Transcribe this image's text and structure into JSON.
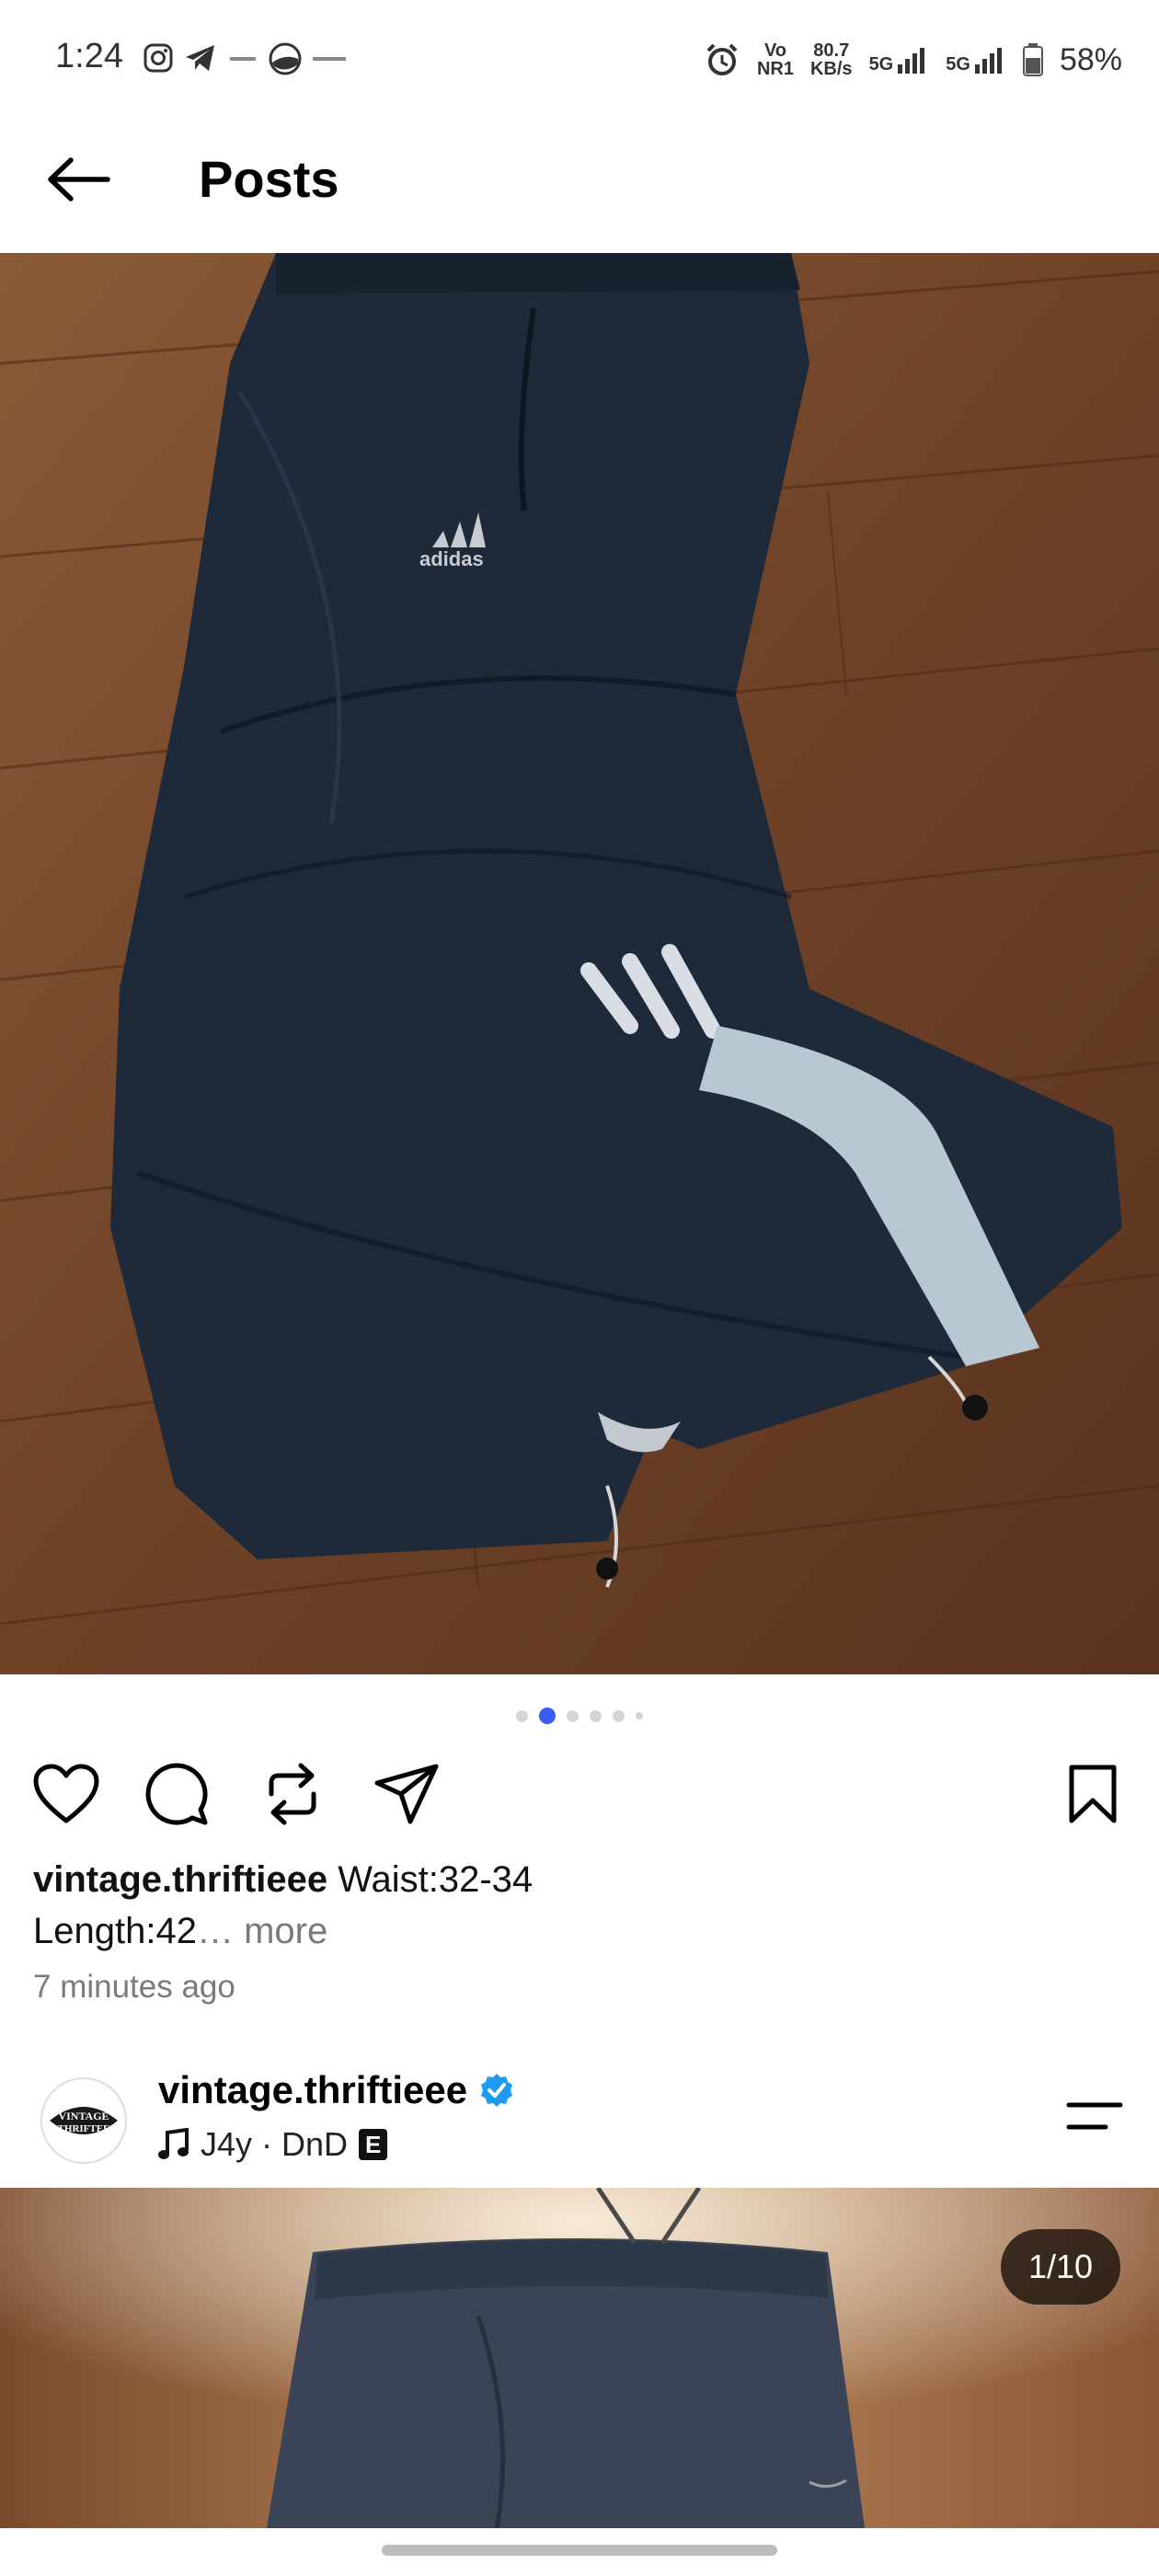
{
  "status_bar": {
    "time": "1:24",
    "left_icons": [
      "instagram-icon",
      "telegram-icon",
      "zepto-icon",
      "zomato-icon"
    ],
    "vo_top": "Vo",
    "vo_bottom": "NR1",
    "speed_top": "80.7",
    "speed_bottom": "KB/s",
    "net1": "5G",
    "net2": "5G",
    "battery": "58%"
  },
  "header": {
    "title": "Posts",
    "back_icon": "arrow-left-icon"
  },
  "post": {
    "carousel_dots": 6,
    "active_dot": 1,
    "username": "vintage.thriftieee",
    "caption_line1": "Waist:32-34",
    "caption_line2": "Length:42",
    "more_label": "… more",
    "time_ago": "7 minutes ago",
    "actions": [
      "heart-icon",
      "comment-icon",
      "repost-icon",
      "share-icon",
      "bookmark-icon"
    ]
  },
  "next_post": {
    "username": "vintage.thriftieee",
    "avatar_text_top": "VINTAGE",
    "avatar_text_bottom": "THRIFTEE",
    "music": "J4y · DnD",
    "explicit": "E",
    "page_counter": "1/10"
  },
  "colors": {
    "accent_dot": "#3a5bf0",
    "verified": "#1d9bf0",
    "floor": "#7a4a2a",
    "pants": "#1c2838"
  }
}
